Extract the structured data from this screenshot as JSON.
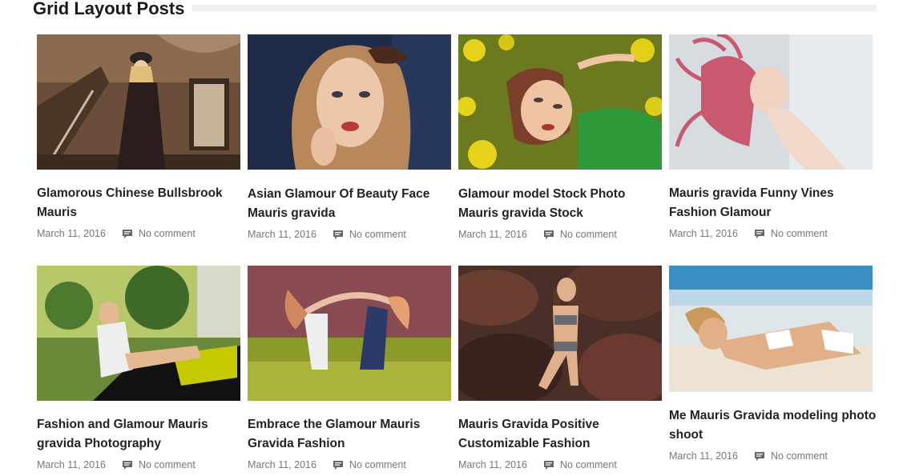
{
  "section": {
    "title": "Grid Layout Posts"
  },
  "posts": [
    {
      "title": "Glamorous Chinese Bullsbrook Mauris",
      "date": "March 11, 2016",
      "comments": "No comment",
      "image_icon": "photo-woman-hat-staircase"
    },
    {
      "title": "Asian Glamour Of Beauty Face Mauris gravida",
      "date": "March 11, 2016",
      "comments": "No comment",
      "image_icon": "photo-woman-portrait"
    },
    {
      "title": "Glamour model Stock Photo Mauris gravida Stock",
      "date": "March 11, 2016",
      "comments": "No comment",
      "image_icon": "photo-woman-yellow-flowers"
    },
    {
      "title": "Mauris gravida Funny Vines Fashion Glamour",
      "date": "March 11, 2016",
      "comments": "No comment",
      "image_icon": "photo-woman-pink-hair"
    },
    {
      "title": "Fashion and Glamour Mauris gravida Photography",
      "date": "March 11, 2016",
      "comments": "No comment",
      "image_icon": "photo-woman-motorcycle"
    },
    {
      "title": "Embrace the Glamour Mauris Gravida Fashion",
      "date": "March 11, 2016",
      "comments": "No comment",
      "image_icon": "photo-two-women-field"
    },
    {
      "title": "Mauris Gravida Positive Customizable Fashion",
      "date": "March 11, 2016",
      "comments": "No comment",
      "image_icon": "photo-woman-rocks"
    },
    {
      "title": "Me Mauris Gravida modeling photo shoot",
      "date": "March 11, 2016",
      "comments": "No comment",
      "image_icon": "photo-woman-beach"
    }
  ],
  "colors": {
    "title": "#222222",
    "meta": "#777777",
    "rule": "#efefef"
  }
}
